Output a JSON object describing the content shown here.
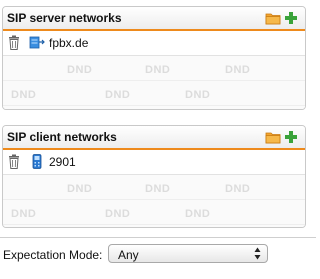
{
  "server_panel": {
    "title": "SIP server networks",
    "items": [
      {
        "label": "fpbx.de",
        "icon": "network-server-icon"
      }
    ],
    "icons": {
      "folder": "folder-icon",
      "add": "plus-icon",
      "delete": "trash-icon"
    },
    "watermark": "DND"
  },
  "client_panel": {
    "title": "SIP client networks",
    "items": [
      {
        "label": "2901",
        "icon": "phone-device-icon"
      }
    ],
    "icons": {
      "folder": "folder-icon",
      "add": "plus-icon",
      "delete": "trash-icon"
    },
    "watermark": "DND"
  },
  "expectation_mode": {
    "label": "Expectation Mode:",
    "value": "Any"
  },
  "colors": {
    "accent": "#ee8a1c",
    "add_green": "#3aa33a",
    "device_blue": "#2a78d0"
  }
}
